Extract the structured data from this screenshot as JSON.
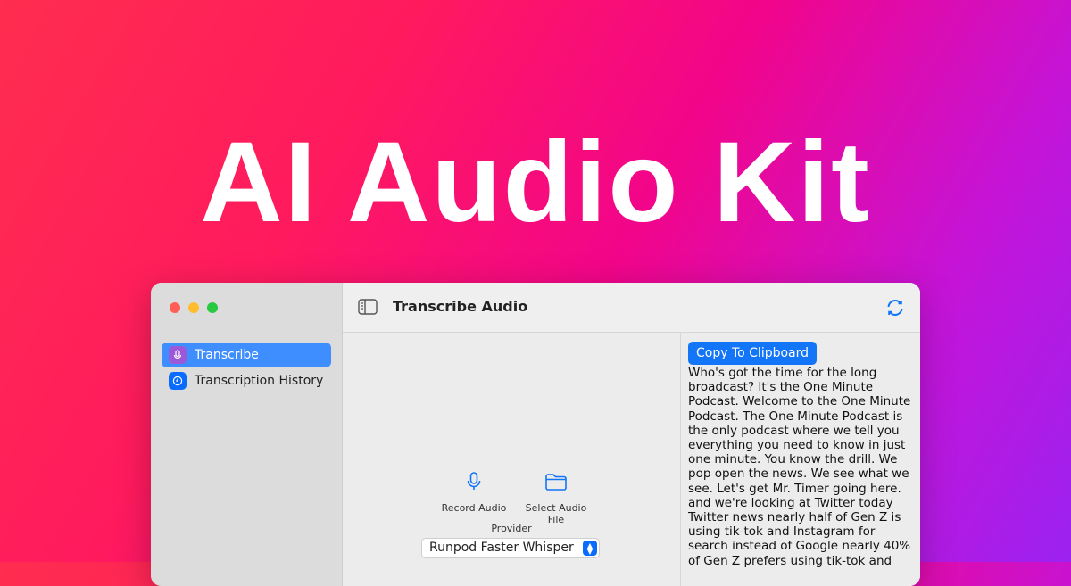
{
  "hero": {
    "title": "AI Audio Kit"
  },
  "sidebar": {
    "items": [
      {
        "label": "Transcribe",
        "icon": "mic-icon",
        "active": true
      },
      {
        "label": "Transcription History",
        "icon": "clock-icon",
        "active": false
      }
    ]
  },
  "toolbar": {
    "title": "Transcribe Audio"
  },
  "actions": {
    "record_label": "Record Audio",
    "select_label": "Select Audio File"
  },
  "provider": {
    "label": "Provider",
    "selected": "Runpod Faster Whisper"
  },
  "output": {
    "copy_label": "Copy To Clipboard",
    "transcript": "Who's got the time for the long broadcast? It's the One Minute Podcast. Welcome to the One Minute Podcast. The One Minute Podcast is the only podcast where we tell you everything you need to know in just one minute. You know the drill. We pop open the news. We see what we see. Let's get Mr. Timer going here. and we're looking at Twitter today Twitter news nearly half of Gen Z is using tik-tok and Instagram for search instead of Google nearly 40% of Gen Z prefers using tik-tok and"
  },
  "colors": {
    "accent": "#1375f7",
    "sidebar_active": "#3e8eff",
    "traffic_red": "#ff5f57",
    "traffic_yellow": "#febc2e",
    "traffic_green": "#28c840"
  }
}
